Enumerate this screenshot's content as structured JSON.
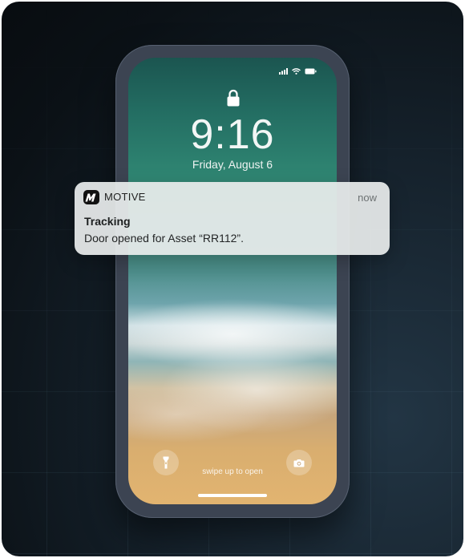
{
  "lockscreen": {
    "time": "9:16",
    "date": "Friday, August 6",
    "swipe_hint": "swipe up to open"
  },
  "status_bar": {
    "icons": [
      "signal-icon",
      "wifi-icon",
      "battery-icon"
    ]
  },
  "notification": {
    "app_name": "MOTIVE",
    "app_icon_letter": "M",
    "time": "now",
    "title": "Tracking",
    "body": "Door opened for Asset “RR112”."
  },
  "colors": {
    "background_dark": "#0b1116",
    "phone_frame": "#3c4452",
    "notification_bg": "#e8ecec",
    "text_dark": "#1d1f20"
  },
  "icons": {
    "lock": "lock-icon",
    "flashlight": "flashlight-icon",
    "camera": "camera-icon"
  }
}
